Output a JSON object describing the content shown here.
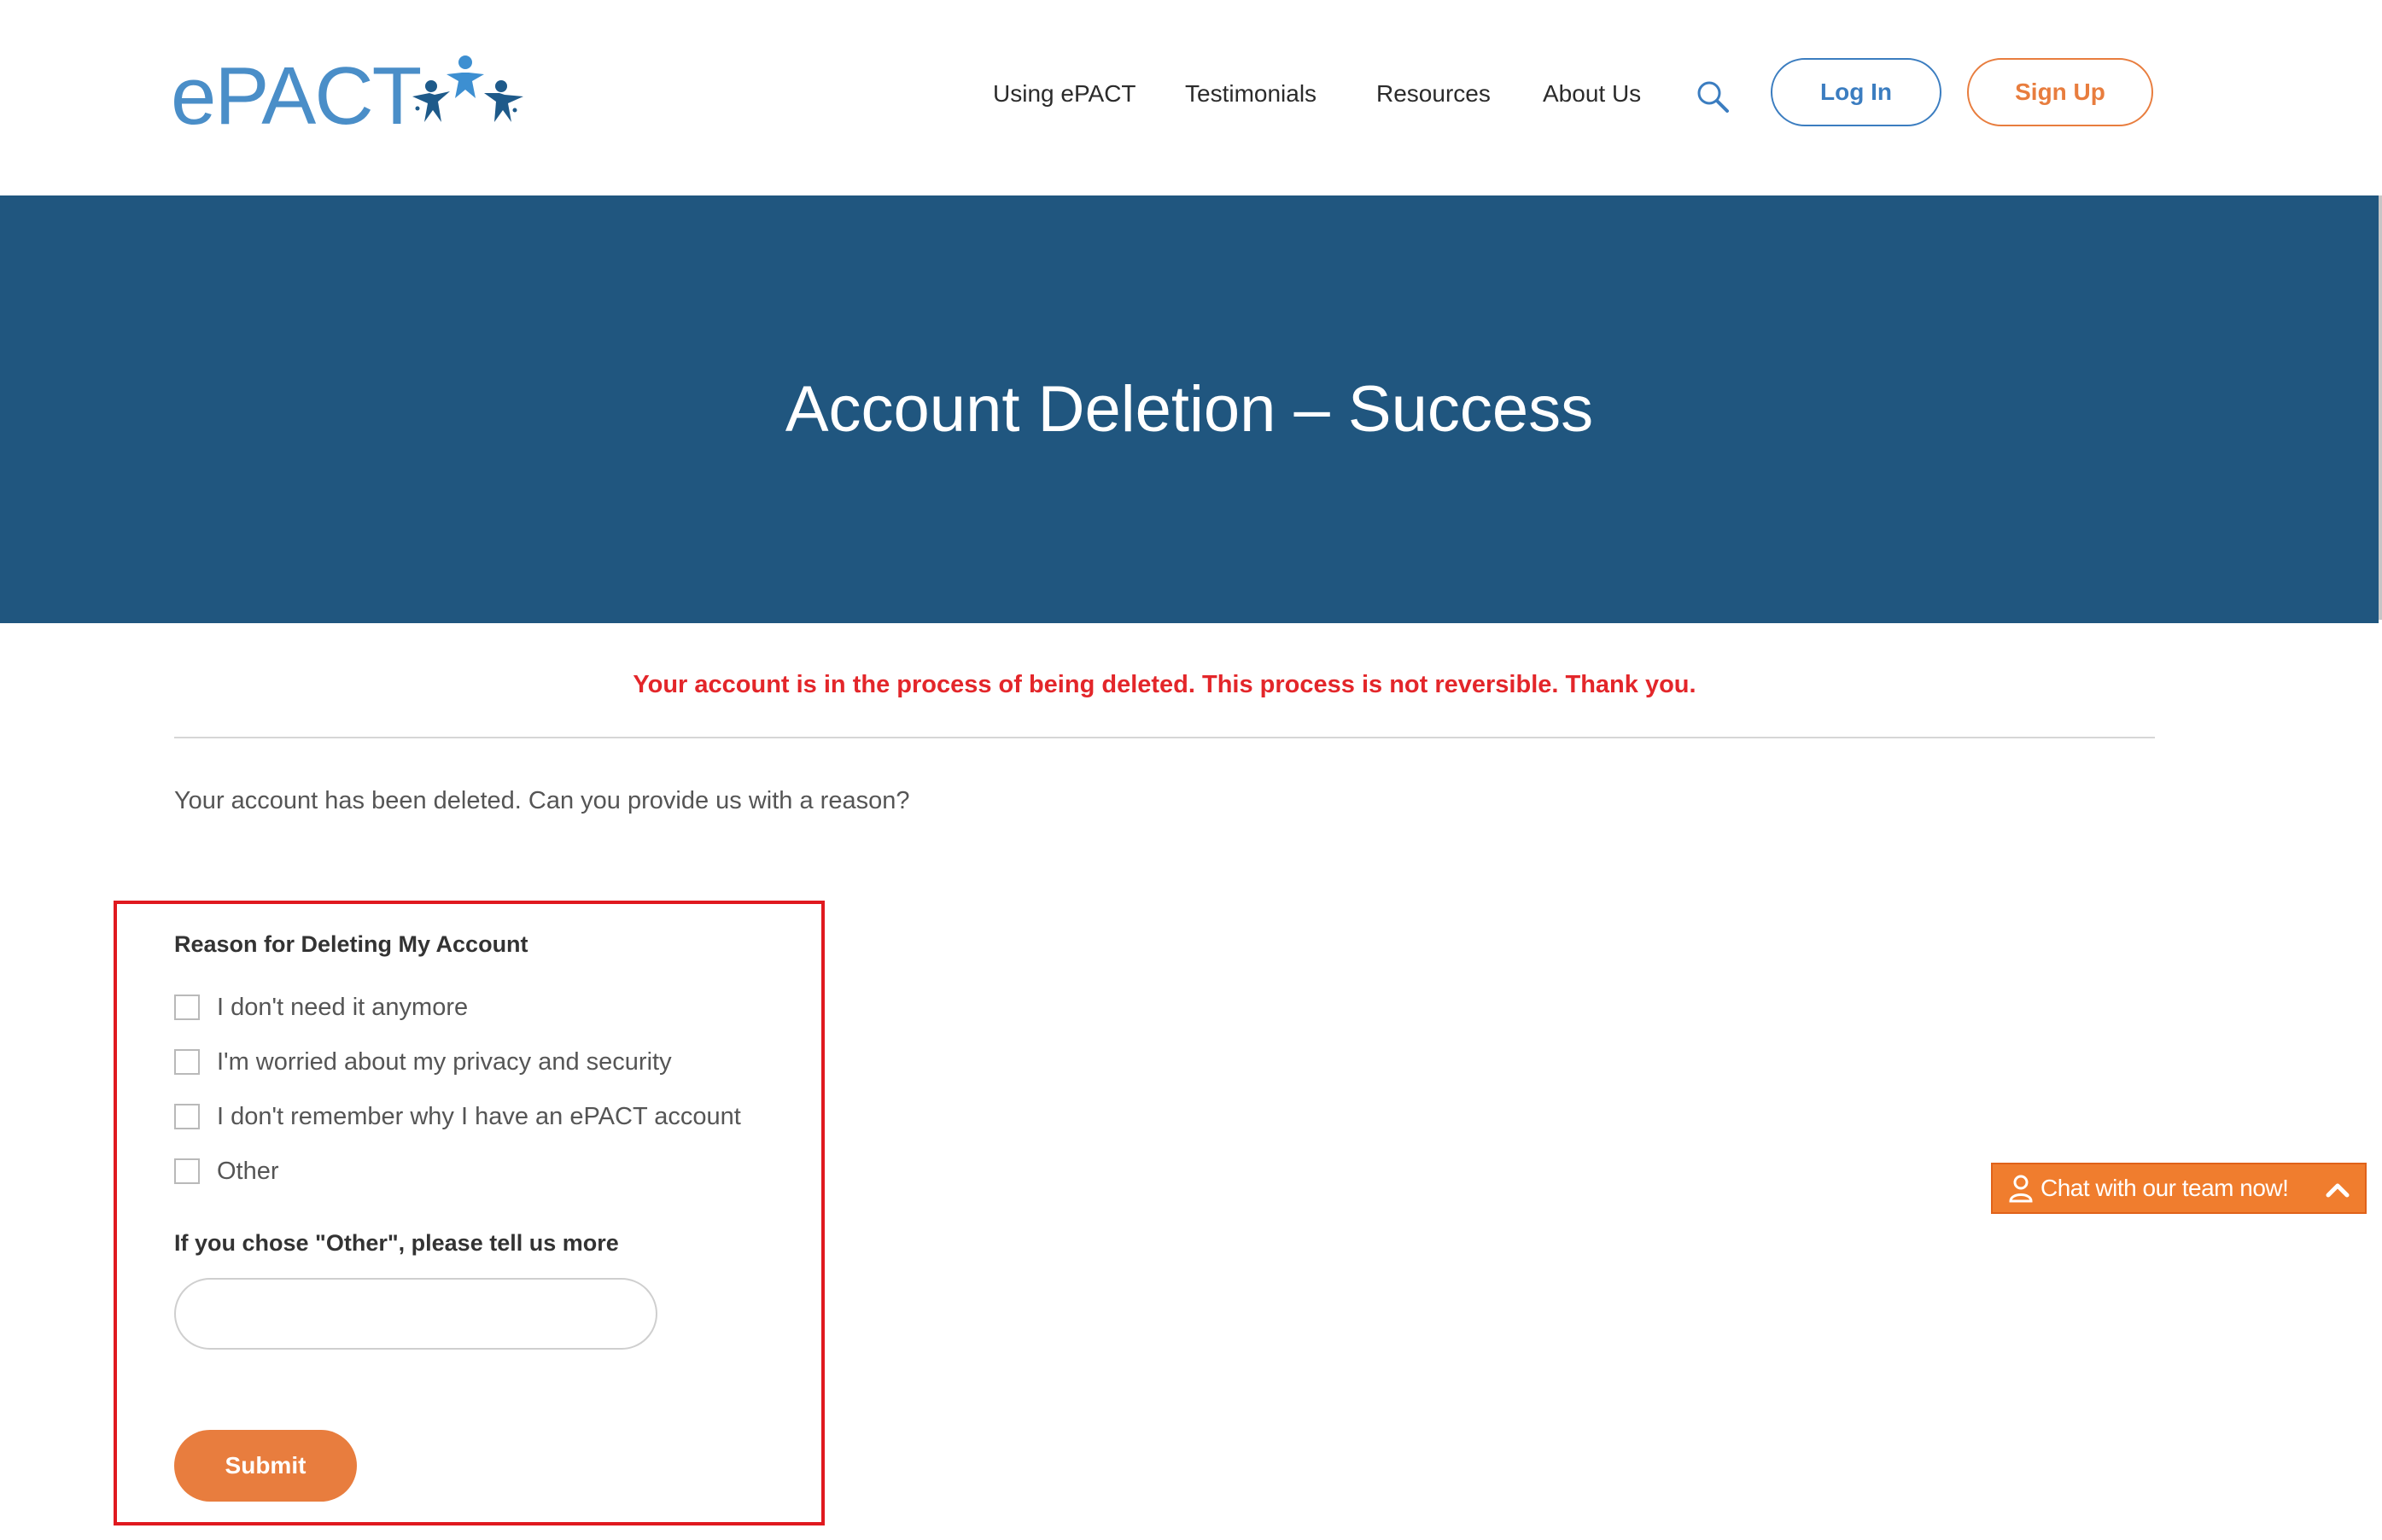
{
  "header": {
    "logo_text": "ePACT",
    "nav": [
      {
        "label": "Using ePACT"
      },
      {
        "label": "Testimonials"
      },
      {
        "label": "Resources"
      },
      {
        "label": "About Us"
      }
    ],
    "search_icon": "search-icon",
    "login_label": "Log In",
    "signup_label": "Sign Up"
  },
  "banner": {
    "title": "Account Deletion – Success"
  },
  "notice": "Your account is in the process of being deleted. This process is not reversible. Thank you.",
  "prompt": "Your account has been deleted. Can you provide us with a reason?",
  "form": {
    "reason_label": "Reason for Deleting My Account",
    "options": [
      {
        "label": "I don't need it anymore",
        "checked": false
      },
      {
        "label": "I'm worried about my privacy and security",
        "checked": false
      },
      {
        "label": "I don't remember why I have an ePACT account",
        "checked": false
      },
      {
        "label": "Other",
        "checked": false
      }
    ],
    "other_label": "If you chose \"Other\", please tell us more",
    "other_value": "",
    "submit_label": "Submit"
  },
  "chat": {
    "label": "Chat with our team now!",
    "icons": [
      "person-icon",
      "chevron-up-icon"
    ]
  },
  "colors": {
    "brand_blue": "#4a8ec8",
    "banner_blue": "#20567f",
    "accent_orange": "#e87d3e",
    "alert_red": "#e3262a",
    "highlight_red": "#e0191f"
  }
}
